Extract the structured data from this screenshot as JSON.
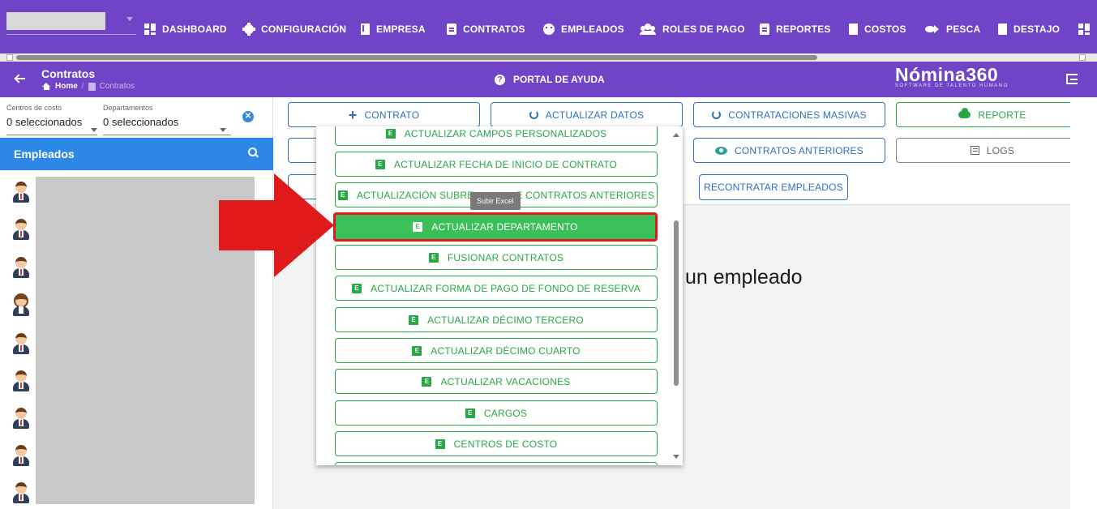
{
  "nav": {
    "items": [
      {
        "label": "DASHBOARD",
        "icon": "dashboard-icon"
      },
      {
        "label": "CONFIGURACIÓN",
        "icon": "gear-icon"
      },
      {
        "label": "EMPRESA",
        "icon": "building-icon"
      },
      {
        "label": "CONTRATOS",
        "icon": "clipboard-icon"
      },
      {
        "label": "EMPLEADOS",
        "icon": "face-icon"
      },
      {
        "label": "ROLES DE PAGO",
        "icon": "users-icon"
      },
      {
        "label": "REPORTES",
        "icon": "clipboard-icon"
      },
      {
        "label": "COSTOS",
        "icon": "invoice-icon"
      },
      {
        "label": "PESCA",
        "icon": "fish-icon"
      },
      {
        "label": "DESTAJO",
        "icon": "document-icon"
      }
    ]
  },
  "header": {
    "title": "Contratos",
    "breadcrumb_home": "Home",
    "breadcrumb_sep": "/",
    "breadcrumb_current": "Contratos",
    "help_label": "PORTAL DE AYUDA",
    "logo_main": "Nómina360",
    "logo_sub": "SOFTWARE DE TALENTO HUMANO"
  },
  "filters": {
    "cost_centers_label": "Centros de costo",
    "cost_centers_value": "0 seleccionados",
    "departments_label": "Departamentos",
    "departments_value": "0 seleccionados",
    "clear_icon": "x-circle-icon"
  },
  "employees": {
    "title": "Empleados",
    "avatar_count": 9
  },
  "toolbar": {
    "contract": "CONTRATO",
    "update_data": "ACTUALIZAR DATOS",
    "mass_hiring": "CONTRATACIONES MASIVAS",
    "report": "REPORTE",
    "previous_contracts": "CONTRATOS ANTERIORES",
    "logs": "LOGS",
    "rehire": "RECONTRATAR EMPLEADOS"
  },
  "main": {
    "select_message": "un empleado"
  },
  "dropdown": {
    "tooltip": "Subir Excel",
    "items": [
      "ACTUALIZAR CAMPOS PERSONALIZADOS",
      "ACTUALIZAR FECHA DE INICIO DE CONTRATO",
      "ACTUALIZACIÓN SUBRE",
      "E CONTRATOS ANTERIORES",
      "ACTUALIZAR DEPARTAMENTO",
      "FUSIONAR CONTRATOS",
      "ACTUALIZAR FORMA DE PAGO DE FONDO DE RESERVA",
      "ACTUALIZAR DÉCIMO TERCERO",
      "ACTUALIZAR DÉCIMO CUARTO",
      "ACTUALIZAR VACACIONES",
      "CARGOS",
      "CENTROS DE COSTO"
    ],
    "excel_badge": "E",
    "active_index": 4
  },
  "colors": {
    "brand_purple": "#6f44c7",
    "primary_blue": "#2d87e6",
    "success_green": "#28a745",
    "highlight_red": "#e0191b"
  }
}
